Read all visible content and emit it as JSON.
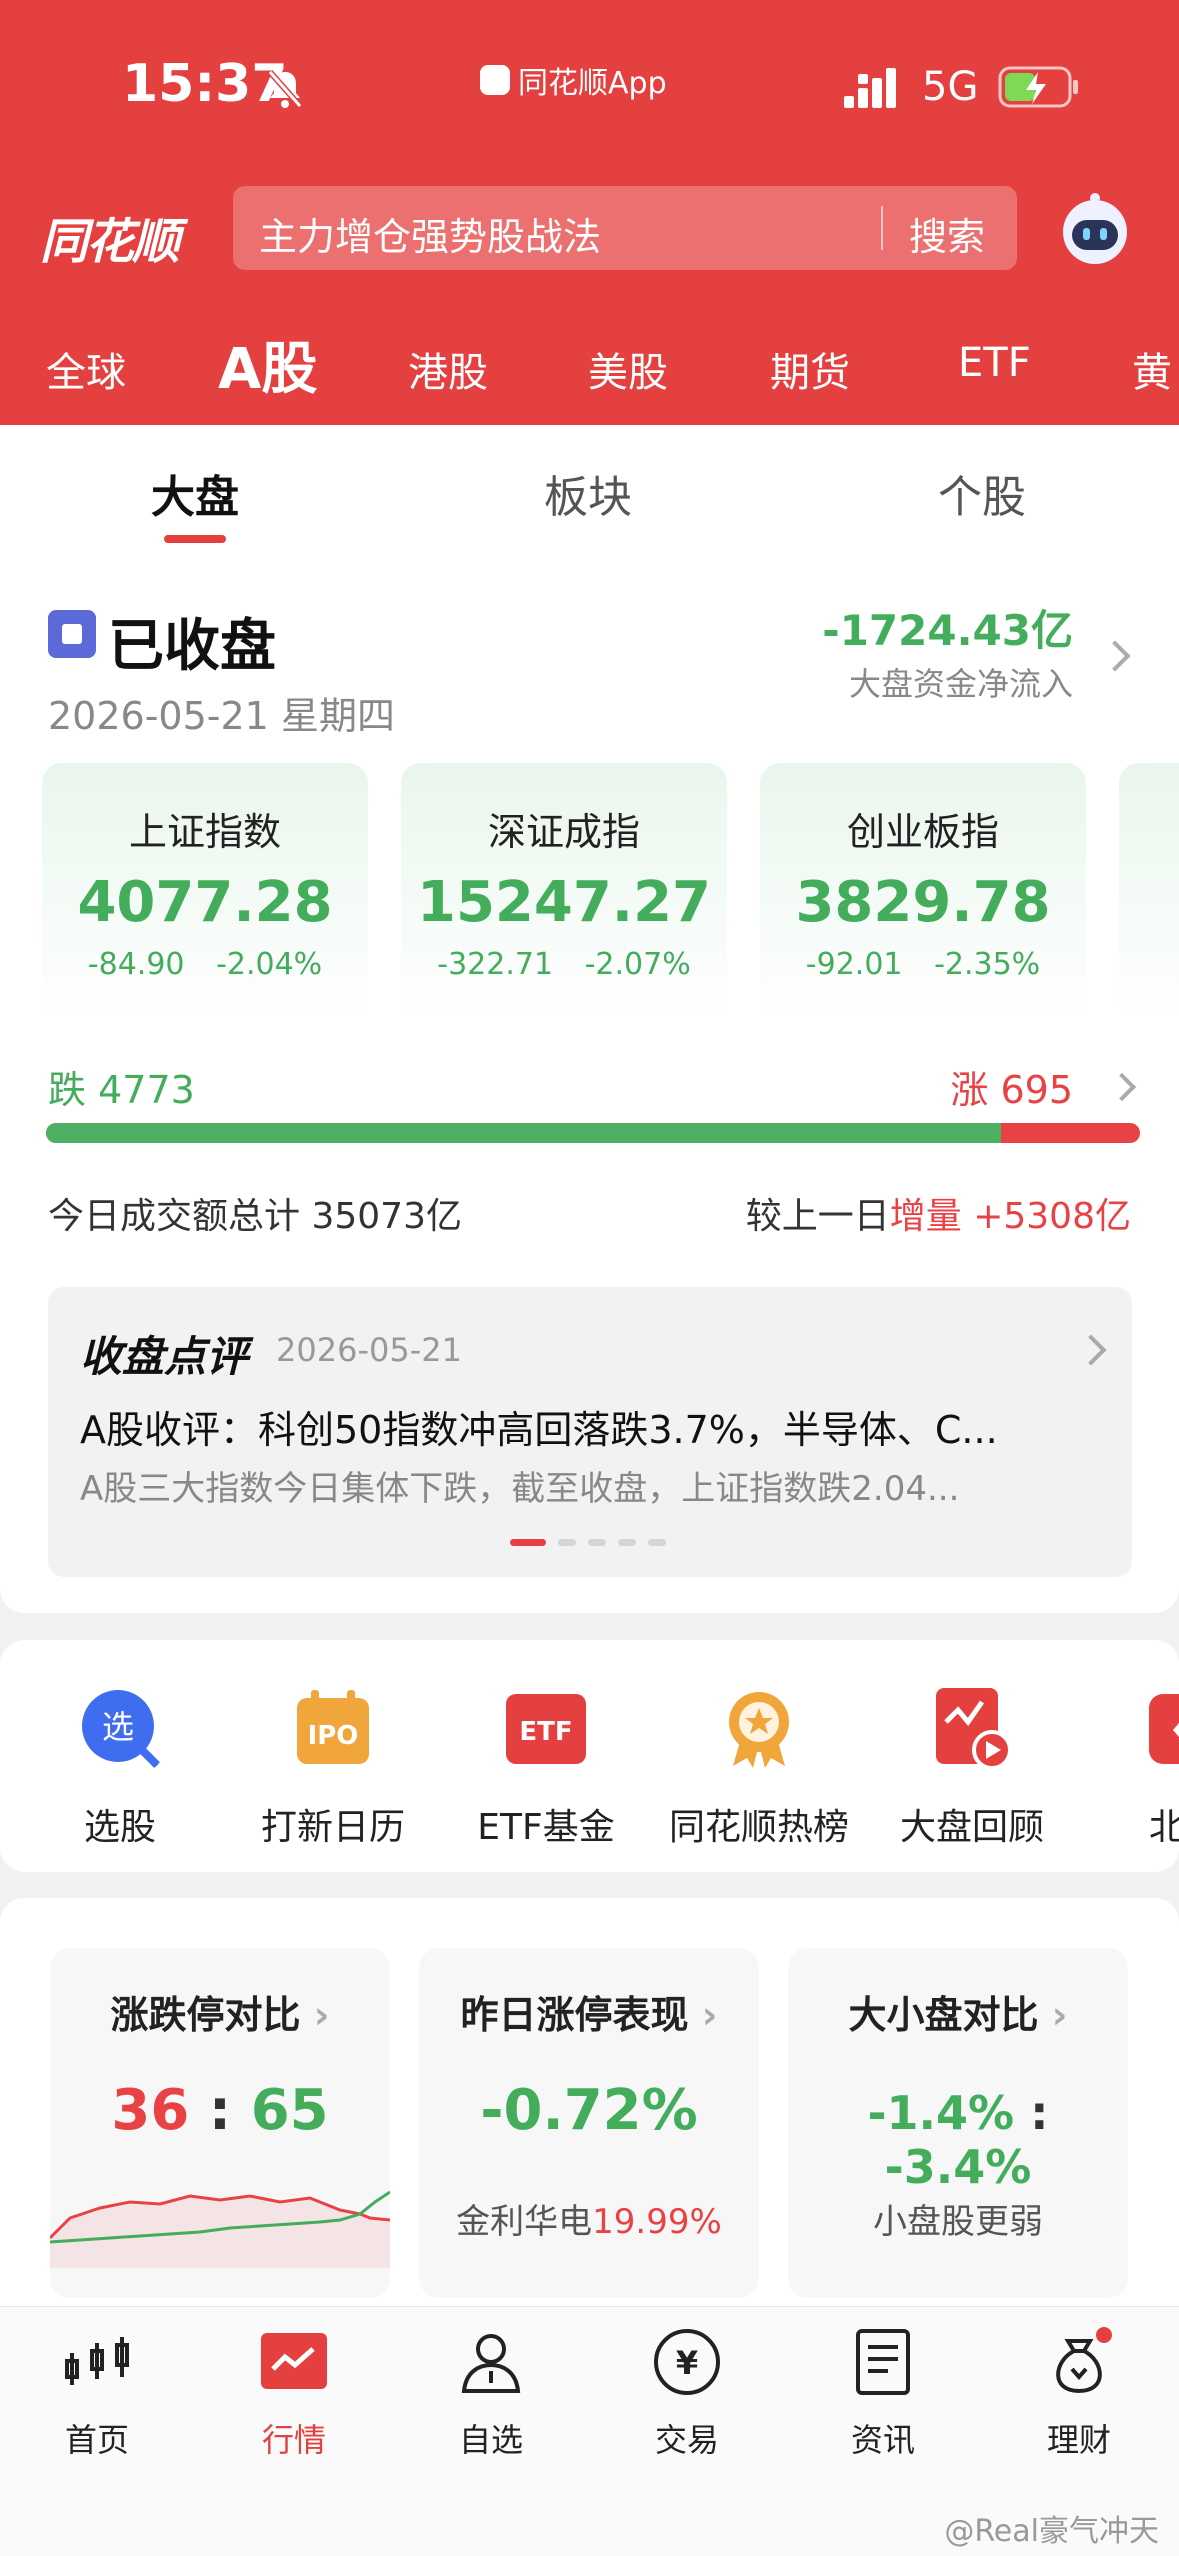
{
  "status_bar": {
    "time": "15:37",
    "app_name": "同花顺App",
    "network": "5G",
    "icons": [
      "bell-off-icon",
      "signal-icon",
      "battery-charging-icon"
    ]
  },
  "header": {
    "logo": "同花顺",
    "search": {
      "placeholder": "主力增仓强势股战法",
      "button": "搜索"
    },
    "assistant_icon": "robot-icon",
    "market_tabs": [
      "全球",
      "A股",
      "港股",
      "美股",
      "期货",
      "ETF",
      "黄"
    ],
    "active_market_tab": "A股"
  },
  "sub_tabs": {
    "items": [
      "大盘",
      "板块",
      "个股"
    ],
    "active": "大盘"
  },
  "market_status": {
    "status": "已收盘",
    "date": "2026-05-21",
    "weekday": "星期四",
    "net_flow": "-1724.43亿",
    "net_flow_label": "大盘资金净流入"
  },
  "indices": [
    {
      "name": "上证指数",
      "value": "4077.28",
      "change": "-84.90",
      "pct": "-2.04%"
    },
    {
      "name": "深证成指",
      "value": "15247.27",
      "change": "-322.71",
      "pct": "-2.07%"
    },
    {
      "name": "创业板指",
      "value": "3829.78",
      "change": "-92.01",
      "pct": "-2.35%"
    }
  ],
  "breadth": {
    "down_label": "跌",
    "down": "4773",
    "up_label": "涨",
    "up": "695",
    "down_fraction": 0.873
  },
  "turnover": {
    "label": "今日成交额总计",
    "value": "35073亿",
    "compare_label": "较上一日",
    "compare_type": "增量",
    "compare_value": "+5308亿"
  },
  "review": {
    "logo": "收盘点评",
    "date": "2026-05-21",
    "headline": "A股收评：科创50指数冲高回落跌3.7%，半导体、C...",
    "summary": "A股三大指数今日集体下跌，截至收盘，上证指数跌2.04...",
    "pages": 5,
    "active_page": 1
  },
  "tools": [
    {
      "label": "选股",
      "icon": "select-stock-icon",
      "color": "#3f6df0"
    },
    {
      "label": "打新日历",
      "icon": "ipo-calendar-icon",
      "color": "#f0a63a"
    },
    {
      "label": "ETF基金",
      "icon": "etf-icon",
      "color": "#e4403f"
    },
    {
      "label": "同花顺热榜",
      "icon": "hot-list-medal-icon",
      "color": "#f0a63a"
    },
    {
      "label": "大盘回顾",
      "icon": "market-replay-icon",
      "color": "#e4403f"
    },
    {
      "label": "北交",
      "icon": "bse-icon",
      "color": "#e4403f"
    }
  ],
  "summary_cards": [
    {
      "title": "涨跌停对比",
      "up": "36",
      "sep": ":",
      "down": "65"
    },
    {
      "title": "昨日涨停表现",
      "value": "-0.72%",
      "stock": "金利华电",
      "stock_pct": "19.99%"
    },
    {
      "title": "大小盘对比",
      "large": "-1.4%",
      "sep": ":",
      "small": "-3.4%",
      "note": "小盘股更弱"
    }
  ],
  "bottom_tabs": [
    {
      "label": "首页",
      "icon": "candlestick-icon"
    },
    {
      "label": "行情",
      "icon": "market-chart-icon"
    },
    {
      "label": "自选",
      "icon": "user-watchlist-icon"
    },
    {
      "label": "交易",
      "icon": "yen-trade-icon"
    },
    {
      "label": "资讯",
      "icon": "news-doc-icon"
    },
    {
      "label": "理财",
      "icon": "money-bag-icon"
    }
  ],
  "active_bottom_tab": "行情",
  "watermark": "@Real豪气冲天"
}
